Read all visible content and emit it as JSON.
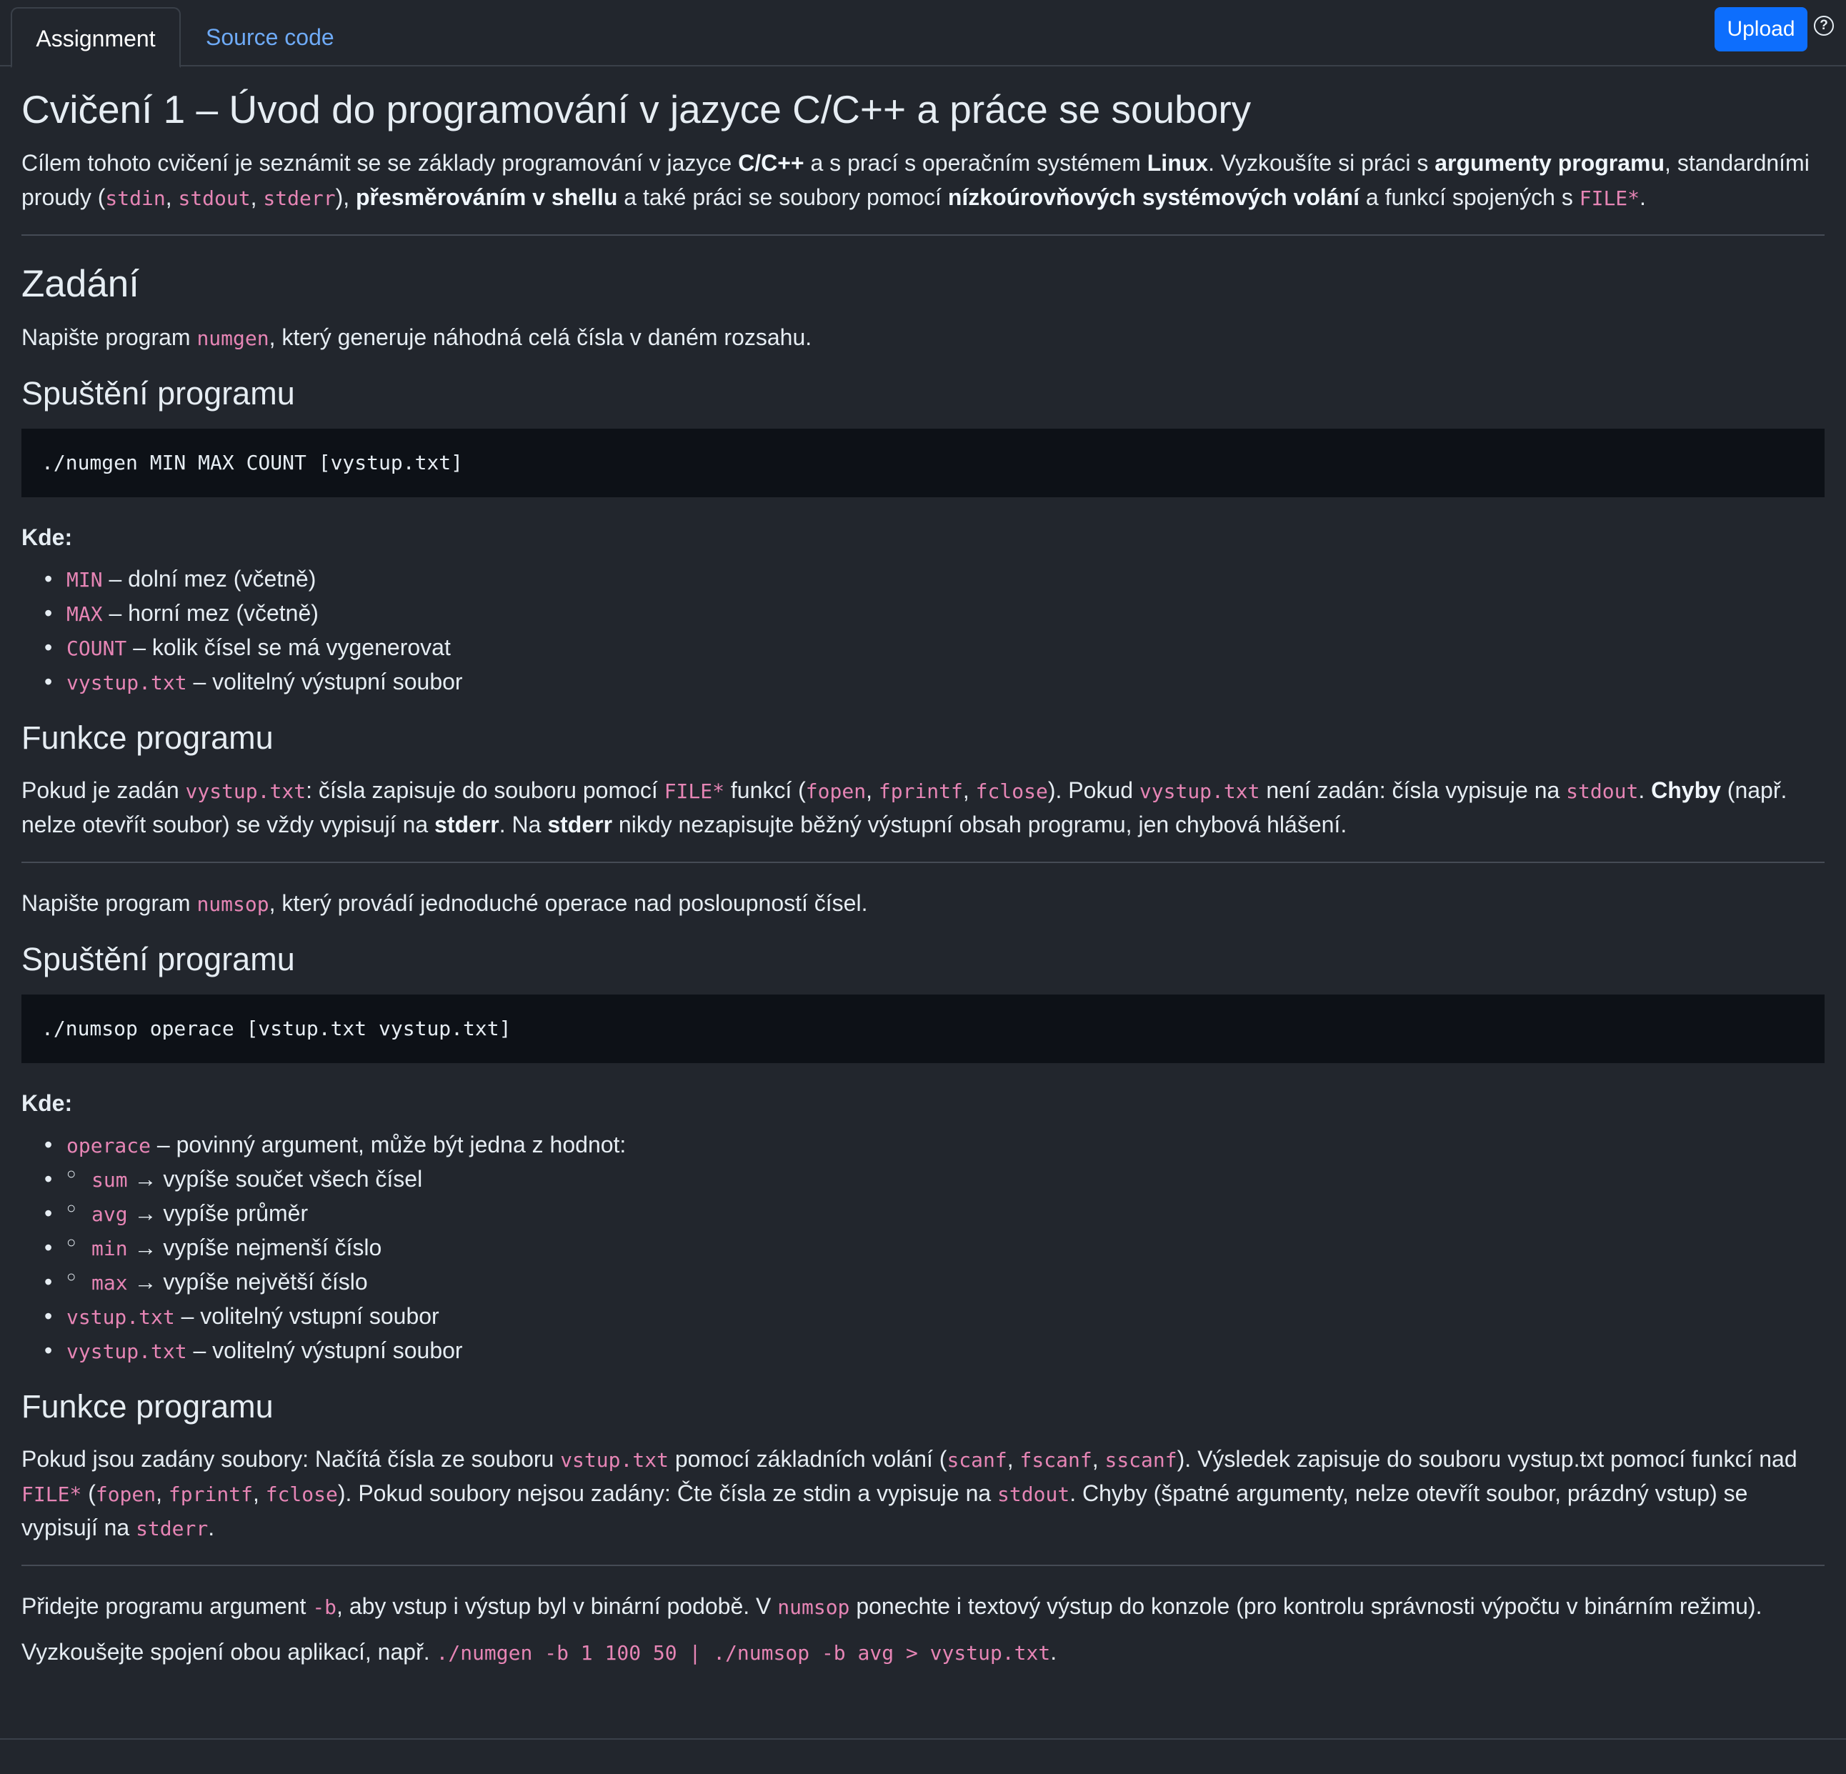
{
  "tabs": {
    "assignment": "Assignment",
    "source_code": "Source code",
    "upload": "Upload",
    "help": "?"
  },
  "title": "Cvičení 1 – Úvod do programování v jazyce C/C++ a práce se soubory",
  "intro": {
    "t1": "Cílem tohoto cvičení je seznámit se se základy programování v jazyce ",
    "b1": "C/C++",
    "t2": " a s prací s operačním systémem ",
    "b2": "Linux",
    "t3": ". Vyzkoušíte si práci s ",
    "b3": "argumenty programu",
    "t4": ", standardními proudy (",
    "c1": "stdin",
    "c2": "stdout",
    "c3": "stderr",
    "t5": "), ",
    "b4": "přesměrováním v shellu",
    "t6": " a také práci se soubory pomocí ",
    "b5": "nízkoúrovňových systémových volání",
    "t7": " a funkcí spojených s ",
    "c4": "FILE*",
    "t8": "."
  },
  "zadani": {
    "heading": "Zadání",
    "p1_a": "Napište program ",
    "p1_code": "numgen",
    "p1_b": ", který generuje náhodná celá čísla v daném rozsahu.",
    "run_heading": "Spuštění programu",
    "cmd": "./numgen MIN MAX COUNT [vystup.txt]",
    "kde": "Kde:",
    "items": [
      {
        "code": "MIN",
        "text": " – dolní mez (včetně)"
      },
      {
        "code": "MAX",
        "text": " – horní mez (včetně)"
      },
      {
        "code": "COUNT",
        "text": " – kolik čísel se má vygenerovat"
      },
      {
        "code": "vystup.txt",
        "text": " – volitelný výstupní soubor"
      }
    ],
    "func_heading": "Funkce programu",
    "f": {
      "t1": "Pokud je zadán ",
      "c1": "vystup.txt",
      "t2": ": čísla zapisuje do souboru pomocí ",
      "c2": "FILE*",
      "t3": " funkcí (",
      "c3": "fopen",
      "c4": "fprintf",
      "c5": "fclose",
      "t4": "). Pokud ",
      "c6": "vystup.txt",
      "t5": " není zadán: čísla vypisuje na ",
      "c7": "stdout",
      "t6": ". ",
      "b1": "Chyby",
      "t7": " (např. nelze otevřít soubor) se vždy vypisují na ",
      "b2": "stderr",
      "t8": ". Na ",
      "b3": "stderr",
      "t9": " nikdy nezapisujte běžný výstupní obsah programu, jen chybová hlášení."
    }
  },
  "numsop": {
    "p1_a": "Napište program ",
    "p1_code": "numsop",
    "p1_b": ", který provádí jednoduché operace nad posloupností čísel.",
    "run_heading": "Spuštění programu",
    "cmd": "./numsop operace [vstup.txt vystup.txt]",
    "kde": "Kde:",
    "op_code": "operace",
    "op_text": " – povinný argument, může být jedna z hodnot:",
    "subs": [
      {
        "code": "sum",
        "text": " → vypíše součet všech čísel"
      },
      {
        "code": "avg",
        "text": " → vypíše průměr"
      },
      {
        "code": "min",
        "text": " → vypíše nejmenší číslo"
      },
      {
        "code": "max",
        "text": " → vypíše největší číslo"
      }
    ],
    "in_code": "vstup.txt",
    "in_text": " – volitelný vstupní soubor",
    "out_code": "vystup.txt",
    "out_text": " – volitelný výstupní soubor",
    "func_heading": "Funkce programu",
    "f": {
      "t1": "Pokud jsou zadány soubory: Načítá čísla ze souboru ",
      "c1": "vstup.txt",
      "t2": " pomocí základních volání (",
      "c2": "scanf",
      "c3": "fscanf",
      "c4": "sscanf",
      "t3": "). Výsledek zapisuje do souboru vystup.txt pomocí funkcí nad ",
      "c5": "FILE*",
      "t4": " (",
      "c6": "fopen",
      "c7": "fprintf",
      "c8": "fclose",
      "t5": "). Pokud soubory nejsou zadány: Čte čísla ze stdin a vypisuje na ",
      "c9": "stdout",
      "t6": ". Chyby (špatné argumenty, nelze otevřít soubor, prázdný vstup) se vypisují na ",
      "c10": "stderr",
      "t7": "."
    }
  },
  "binary": {
    "t1": "Přidejte programu argument ",
    "c1": "-b",
    "t2": ", aby vstup i výstup byl v binární podobě. V ",
    "c2": "numsop",
    "t3": " ponechte i textový výstup do konzole (pro kontrolu správnosti výpočtu v binárním režimu).",
    "t4": "Vyzkoušejte spojení obou aplikací, např. ",
    "c3": "./numgen -b 1 100 50 | ./numsop -b avg > vystup.txt",
    "t5": "."
  },
  "separators": {
    "comma": ", "
  }
}
